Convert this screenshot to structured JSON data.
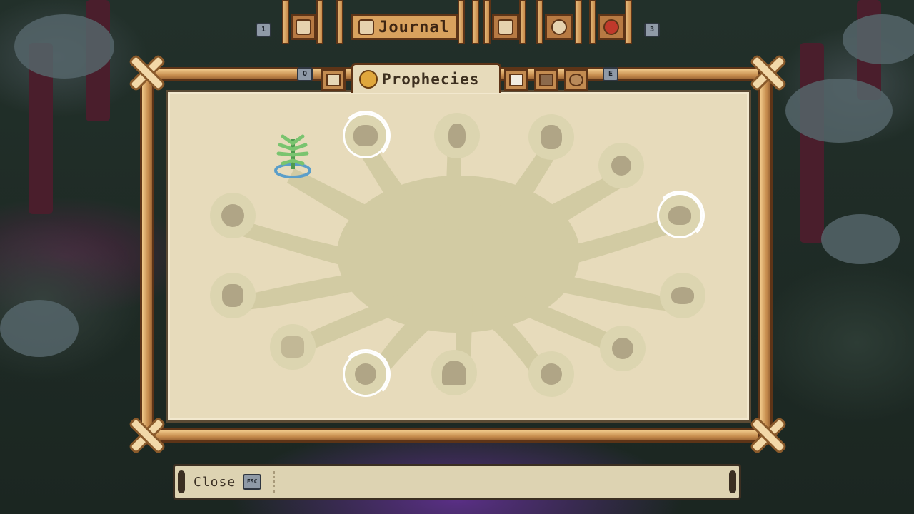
{
  "top_bar": {
    "left_key": "1",
    "right_key": "3",
    "active_tab_label": "Journal",
    "buttons": [
      {
        "name": "inventory",
        "icon": "backpack-icon"
      },
      {
        "name": "journal",
        "icon": "scroll-icon"
      },
      {
        "name": "map",
        "icon": "map-icon"
      },
      {
        "name": "settings",
        "icon": "gear-icon"
      },
      {
        "name": "quit",
        "icon": "no-entry-icon"
      }
    ]
  },
  "tabs": {
    "left_key": "Q",
    "right_key": "E",
    "active_label": "Prophecies",
    "items": [
      {
        "name": "tasks",
        "icon": "checklist-icon"
      },
      {
        "name": "prophecies",
        "icon": "egg-icon",
        "active": true
      },
      {
        "name": "calendar",
        "icon": "calendar-icon"
      },
      {
        "name": "villagers",
        "icon": "people-icon"
      },
      {
        "name": "creatures",
        "icon": "paw-icon"
      }
    ]
  },
  "prophecy_nodes": [
    {
      "name": "tree",
      "icon": "sprout-icon",
      "unlocked": true,
      "highlight": false
    },
    {
      "name": "spiral-hand",
      "icon": "spiral-hand-icon",
      "unlocked": false,
      "highlight": true
    },
    {
      "name": "cactus",
      "icon": "cactus-icon",
      "unlocked": false,
      "highlight": false
    },
    {
      "name": "pair",
      "icon": "pair-icon",
      "unlocked": false,
      "highlight": false
    },
    {
      "name": "turnip",
      "icon": "turnip-icon",
      "unlocked": false,
      "highlight": false
    },
    {
      "name": "flower",
      "icon": "flower-icon",
      "unlocked": false,
      "highlight": false
    },
    {
      "name": "pot",
      "icon": "pot-icon",
      "unlocked": false,
      "highlight": true
    },
    {
      "name": "jar",
      "icon": "jar-icon",
      "unlocked": false,
      "highlight": false
    },
    {
      "name": "bowl",
      "icon": "bowl-icon",
      "unlocked": false,
      "highlight": false
    },
    {
      "name": "owl",
      "icon": "owl-icon",
      "unlocked": false,
      "highlight": false
    },
    {
      "name": "paw-heart",
      "icon": "paw-heart-icon",
      "unlocked": false,
      "highlight": true
    },
    {
      "name": "mushroom",
      "icon": "mushroom-icon",
      "unlocked": false,
      "highlight": false
    },
    {
      "name": "moon",
      "icon": "moon-icon",
      "unlocked": false,
      "highlight": false
    },
    {
      "name": "swirl",
      "icon": "swirl-icon",
      "unlocked": false,
      "highlight": false
    }
  ],
  "footer": {
    "close_label": "Close",
    "close_key": "ESC"
  },
  "colors": {
    "parchment": "#e7dbbb",
    "tree_shape": "#d2cba3",
    "wood": "#c78d4e",
    "rope": "#f2d8a8",
    "unlocked_green": "#6fb16a",
    "water_blue": "#5b9ec9"
  }
}
